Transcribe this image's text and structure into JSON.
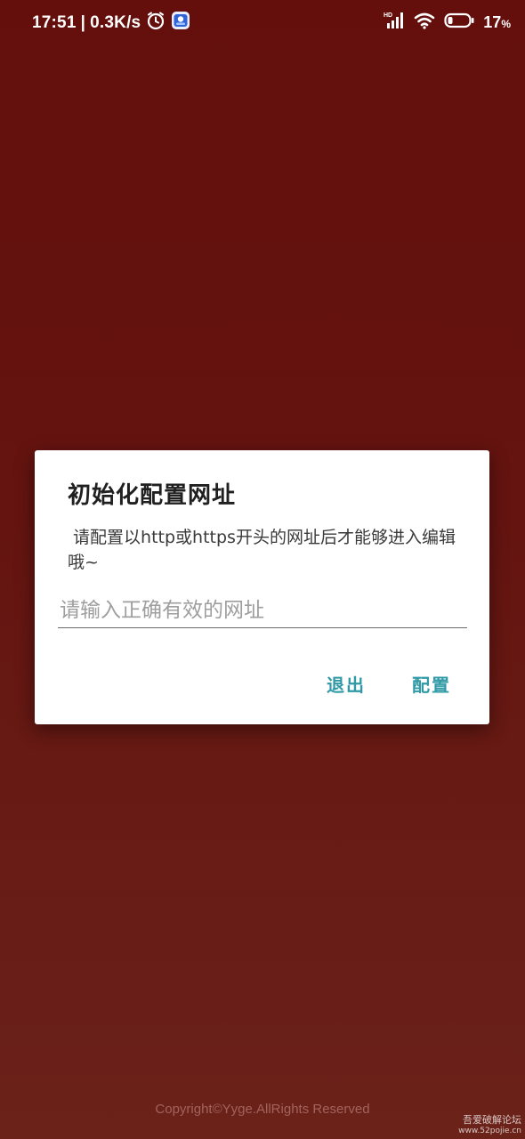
{
  "status_bar": {
    "time": "17:51",
    "separator": "|",
    "net_speed": "0.3K/s",
    "icons": [
      "alarm-icon",
      "app-notification-icon",
      "hd-signal-icon",
      "wifi-icon",
      "battery-icon"
    ],
    "hd_label": "HD",
    "battery_percent": "17",
    "battery_unit": "%"
  },
  "dialog": {
    "title": "初始化配置网址",
    "message": " 请配置以http或https开头的网址后才能够进入编辑哦~",
    "input": {
      "value": "",
      "placeholder": "请输入正确有效的网址"
    },
    "buttons": {
      "exit_label": "退出",
      "config_label": "配置"
    },
    "accent_color": "#2f9aa6"
  },
  "footer": {
    "copyright": "Copyright©Yyge.AllRights Reserved"
  },
  "watermark": {
    "line1": "吾爱破解论坛",
    "line2": "www.52pojie.cn"
  }
}
